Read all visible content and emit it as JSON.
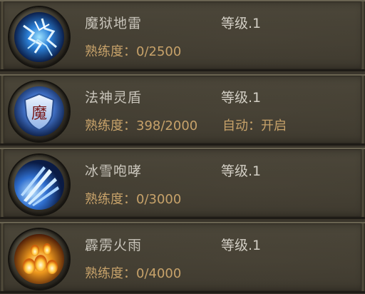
{
  "skills": [
    {
      "name": "魔狱地雷",
      "level": "等级.1",
      "proficiency_label": "熟练度：",
      "proficiency_value": "0/2500",
      "icon": "lightning-icon"
    },
    {
      "name": "法神灵盾",
      "level": "等级.1",
      "proficiency_label": "熟练度：",
      "proficiency_value": "398/2000",
      "auto_label": "自动：",
      "auto_value": "开启",
      "icon": "magic-shield-icon",
      "icon_glyph": "魔"
    },
    {
      "name": "冰雪咆哮",
      "level": "等级.1",
      "proficiency_label": "熟练度：",
      "proficiency_value": "0/3000",
      "icon": "ice-shards-icon"
    },
    {
      "name": "霹雳火雨",
      "level": "等级.1",
      "proficiency_label": "熟练度：",
      "proficiency_value": "0/4000",
      "icon": "fire-rain-icon"
    }
  ],
  "colors": {
    "name_text": "#c9c5bb",
    "level_text": "#d2cec4",
    "proficiency_text": "#c7a26a",
    "panel": "#443f33"
  }
}
